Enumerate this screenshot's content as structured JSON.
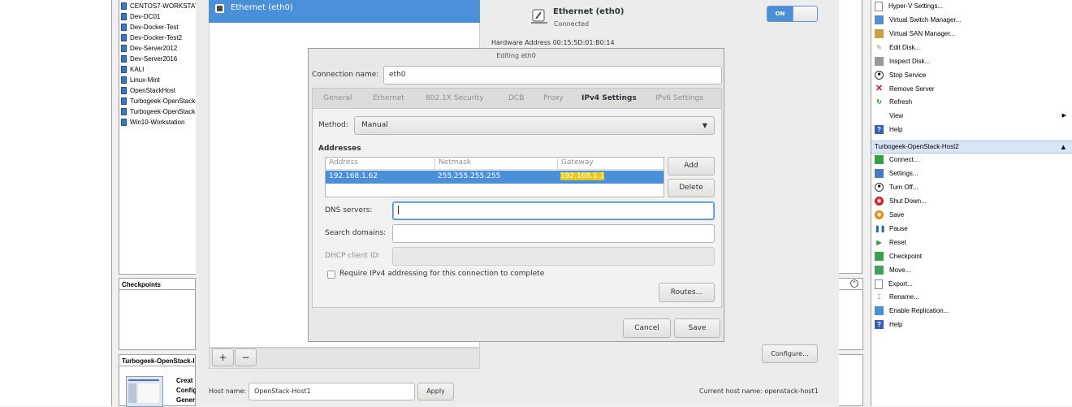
{
  "vm_list": [
    "CENTOS7-WORKSTAT",
    "Dev-DC01",
    "Dev-Docker-Test",
    "Dev-Docker-Test2",
    "Dev-Server2012",
    "Dev-Server2016",
    "KALI",
    "Linux-Mint",
    "OpenStackHost",
    "Turbogeek-OpenStack-",
    "Turbogeek-OpenStack-",
    "Win10-Workstation"
  ],
  "checkpoints_header": "Checkpoints",
  "details_header": "Turbogeek-OpenStack-I",
  "details_lines": [
    "Creat",
    "Config",
    "Gener"
  ],
  "network": {
    "list_item": "Ethernet (eth0)",
    "device_title": "Ethernet (eth0)",
    "device_status": "Connected",
    "toggle_label": "ON",
    "hardware_address": "Hardware Address  00:15:5D:01:B0:14",
    "add_symbol": "+",
    "remove_symbol": "−",
    "configure_label": "Configure...",
    "hostname_label": "Host name:",
    "hostname_value": "OpenStack-Host1",
    "apply_label": "Apply",
    "current_hostname": "Current host name:   openstack-host1"
  },
  "dialog": {
    "title": "Editing eth0",
    "connection_name_label": "Connection name:",
    "connection_name_value": "eth0",
    "tabs": [
      "General",
      "Ethernet",
      "802.1X Security",
      "DCB",
      "Proxy",
      "IPv4 Settings",
      "IPv6 Settings"
    ],
    "method_label": "Method:",
    "method_value": "Manual",
    "addresses_label": "Addresses",
    "columns": [
      "Address",
      "Netmask",
      "Gateway"
    ],
    "row": [
      "192.168.1.62",
      "255.255.255.255",
      "192.168.1.1"
    ],
    "add_label": "Add",
    "delete_label": "Delete",
    "dns_label": "DNS servers:",
    "dns_value": "",
    "search_label": "Search domains:",
    "search_value": "",
    "dhcp_label": "DHCP client ID:",
    "require_label": "Require IPv4 addressing for this connection to complete",
    "routes_label": "Routes...",
    "cancel_label": "Cancel",
    "save_label": "Save"
  },
  "actions": {
    "top": [
      "Hyper-V Settings...",
      "Virtual Switch Manager...",
      "Virtual SAN Manager...",
      "Edit Disk...",
      "Inspect Disk...",
      "Stop Service",
      "Remove Server",
      "Refresh",
      "View",
      "Help"
    ],
    "vm_header": "Turbogeek-OpenStack-Host2",
    "vm": [
      "Connect...",
      "Settings...",
      "Turn Off...",
      "Shut Down...",
      "Save",
      "Pause",
      "Reset",
      "Checkpoint",
      "Move...",
      "Export...",
      "Rename...",
      "Enable Replication...",
      "Help"
    ]
  },
  "colors": {
    "accent": "#4a90d9",
    "highlight": "#f5e534",
    "hv_blue": "#3a76c6"
  }
}
